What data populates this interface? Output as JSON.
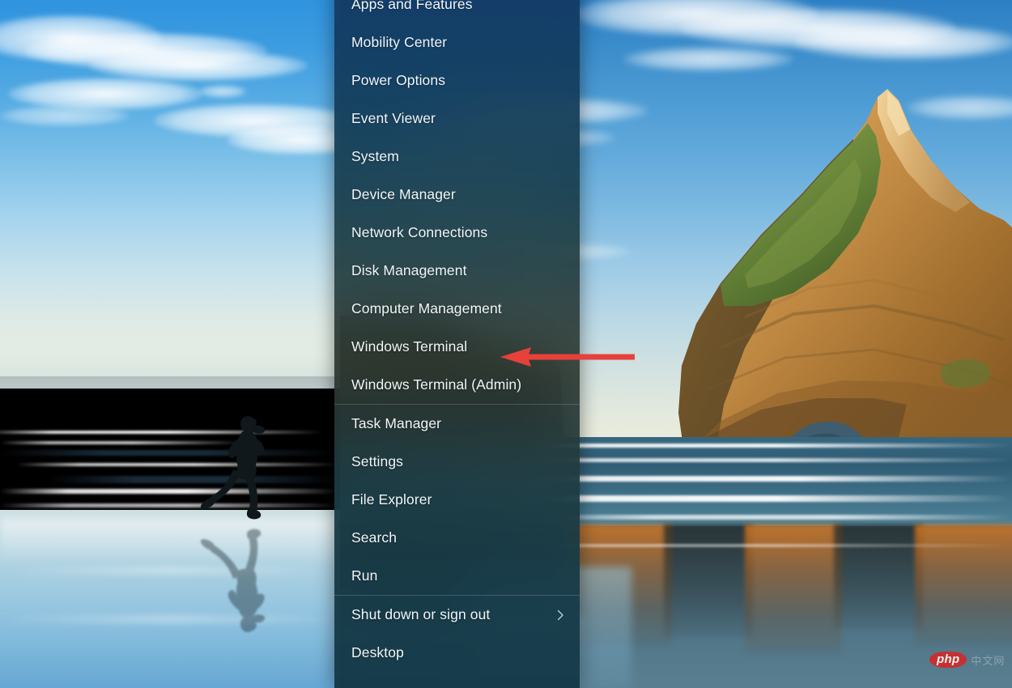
{
  "wallpaper": {
    "description": "Windows 11 desktop wallpaper: beach runner silhouette at left, Archway Islands rock formations at right"
  },
  "context_menu": {
    "name": "Win+X power user menu",
    "groups": [
      {
        "items": [
          {
            "label": "Apps and Features",
            "has_submenu": false
          },
          {
            "label": "Mobility Center",
            "has_submenu": false
          },
          {
            "label": "Power Options",
            "has_submenu": false
          },
          {
            "label": "Event Viewer",
            "has_submenu": false
          },
          {
            "label": "System",
            "has_submenu": false
          },
          {
            "label": "Device Manager",
            "has_submenu": false
          },
          {
            "label": "Network Connections",
            "has_submenu": false
          },
          {
            "label": "Disk Management",
            "has_submenu": false
          },
          {
            "label": "Computer Management",
            "has_submenu": false
          },
          {
            "label": "Windows Terminal",
            "has_submenu": false
          },
          {
            "label": "Windows Terminal (Admin)",
            "has_submenu": false
          }
        ]
      },
      {
        "items": [
          {
            "label": "Task Manager",
            "has_submenu": false
          },
          {
            "label": "Settings",
            "has_submenu": false
          },
          {
            "label": "File Explorer",
            "has_submenu": false
          },
          {
            "label": "Search",
            "has_submenu": false
          },
          {
            "label": "Run",
            "has_submenu": false
          }
        ]
      },
      {
        "items": [
          {
            "label": "Shut down or sign out",
            "has_submenu": true
          },
          {
            "label": "Desktop",
            "has_submenu": false
          }
        ]
      }
    ]
  },
  "annotation": {
    "type": "arrow",
    "direction": "left",
    "color": "#e8403a",
    "points_at": "Windows Terminal"
  },
  "watermark": {
    "logo_text": "php",
    "site_text": "中文网",
    "logo_color": "#cf2b2b"
  }
}
